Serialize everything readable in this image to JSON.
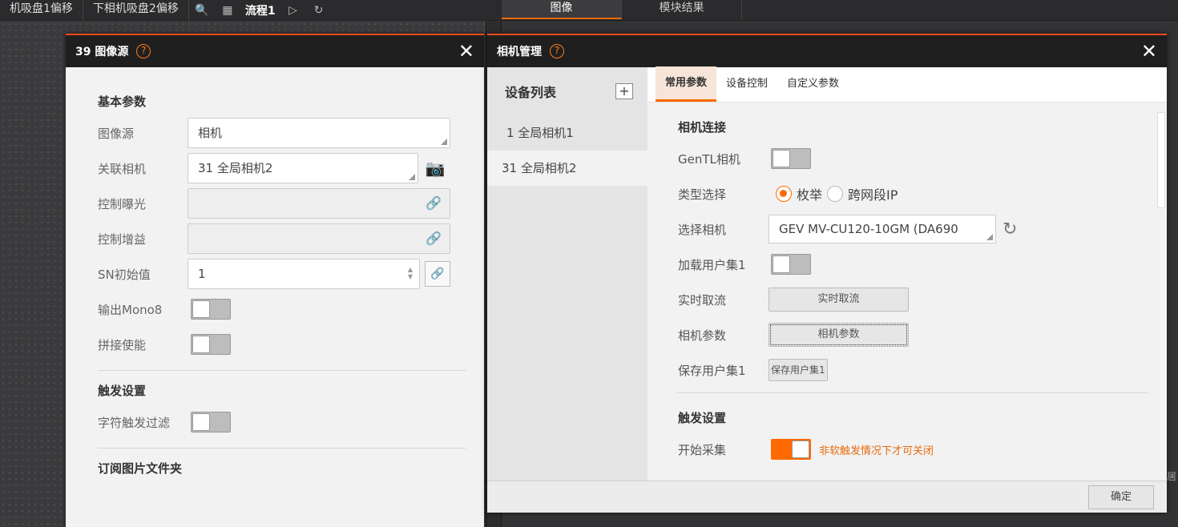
{
  "bg": {
    "tabs": [
      "机吸盘1偏移",
      "下相机吸盘2偏移"
    ],
    "flow_label": "流程1",
    "right_tabs": [
      "图像",
      "模块结果"
    ],
    "edge_char": "居"
  },
  "left_dialog": {
    "title": "39 图像源",
    "help": "?",
    "basic_title": "基本参数",
    "image_source_label": "图像源",
    "image_source_value": "相机",
    "linked_camera_label": "关联相机",
    "linked_camera_value": "31 全局相机2",
    "exposure_label": "控制曝光",
    "gain_label": "控制增益",
    "sn_label": "SN初始值",
    "sn_value": "1",
    "mono8_label": "输出Mono8",
    "stitch_label": "拼接使能",
    "trigger_title": "触发设置",
    "char_filter_label": "字符触发过滤",
    "subscribe_title": "订阅图片文件夹"
  },
  "right_dialog": {
    "title": "相机管理",
    "help": "?",
    "device_list_title": "设备列表",
    "devices": [
      "1  全局相机1",
      "31 全局相机2"
    ],
    "tabs": [
      "常用参数",
      "设备控制",
      "自定义参数"
    ],
    "conn_title": "相机连接",
    "gentl_label": "GenTL相机",
    "type_label": "类型选择",
    "type_opt1": "枚举",
    "type_opt2": "跨网段IP",
    "select_label": "选择相机",
    "select_value": "GEV MV-CU120-10GM (DA690",
    "load_user_label": "加载用户集1",
    "realtime_label": "实时取流",
    "realtime_btn": "实时取流",
    "cam_param_label": "相机参数",
    "cam_param_btn": "相机参数",
    "save_user_label": "保存用户集1",
    "save_user_btn": "保存用户集1",
    "trigger_title": "触发设置",
    "start_label": "开始采集",
    "start_hint": "非软触发情况下才可关闭",
    "ok_btn": "确定"
  },
  "colors": {
    "accent": "#ff6a00",
    "header": "#1f1f1f"
  }
}
